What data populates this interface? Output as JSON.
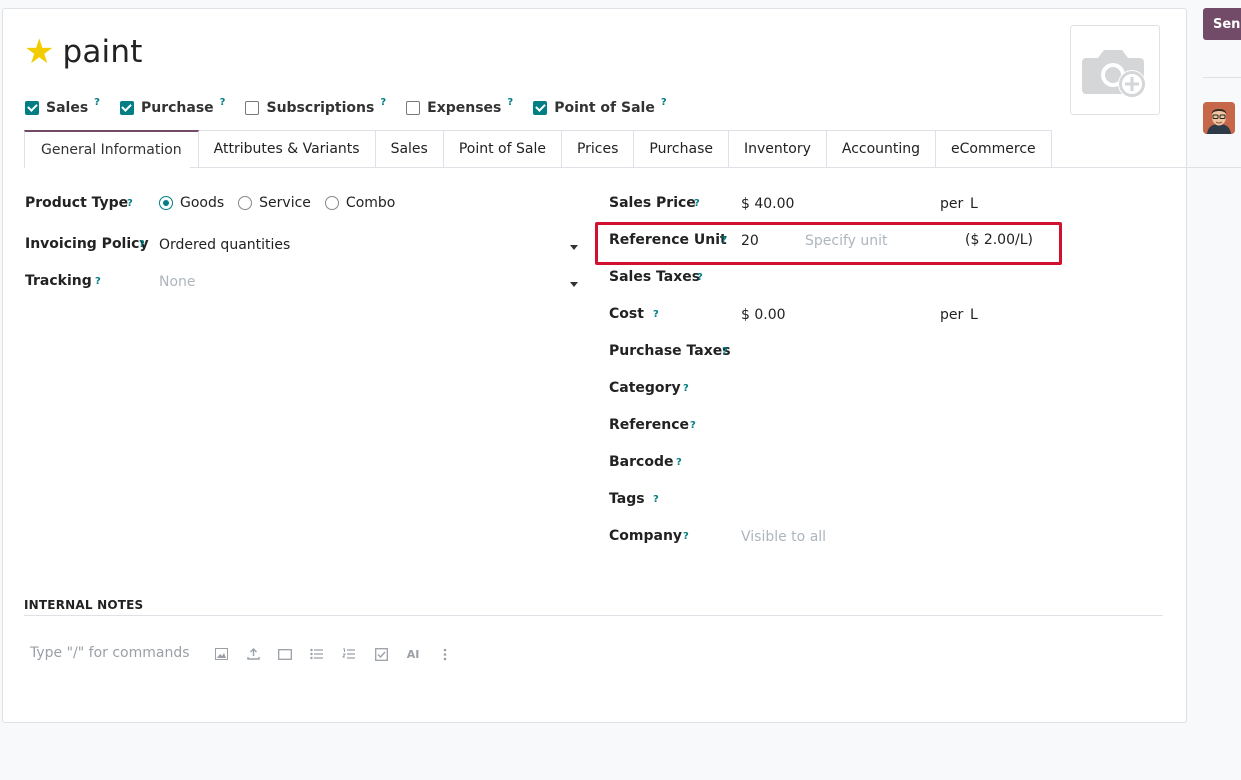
{
  "product": {
    "name": "paint"
  },
  "flags": [
    {
      "label": "Sales",
      "checked": true
    },
    {
      "label": "Purchase",
      "checked": true
    },
    {
      "label": "Subscriptions",
      "checked": false
    },
    {
      "label": "Expenses",
      "checked": false
    },
    {
      "label": "Point of Sale",
      "checked": true
    }
  ],
  "help_mark": "?",
  "tabs": [
    "General Information",
    "Attributes & Variants",
    "Sales",
    "Point of Sale",
    "Prices",
    "Purchase",
    "Inventory",
    "Accounting",
    "eCommerce"
  ],
  "left": {
    "product_type": {
      "label": "Product Type",
      "options": [
        "Goods",
        "Service",
        "Combo"
      ],
      "selected": "Goods"
    },
    "invoicing_policy": {
      "label": "Invoicing Policy",
      "value": "Ordered quantities"
    },
    "tracking": {
      "label": "Tracking",
      "placeholder": "None"
    }
  },
  "right": {
    "sales_price": {
      "label": "Sales Price",
      "value": "$ 40.00",
      "per": "per",
      "unit": "L"
    },
    "reference_unit": {
      "label": "Reference Unit",
      "value": "20",
      "placeholder": "Specify unit",
      "computed": "($ 2.00/L)"
    },
    "sales_taxes": {
      "label": "Sales Taxes"
    },
    "cost": {
      "label": "Cost",
      "value": "$ 0.00",
      "per": "per",
      "unit": "L"
    },
    "purchase_taxes": {
      "label": "Purchase Taxes"
    },
    "category": {
      "label": "Category"
    },
    "reference": {
      "label": "Reference"
    },
    "barcode": {
      "label": "Barcode"
    },
    "tags": {
      "label": "Tags"
    },
    "company": {
      "label": "Company",
      "placeholder": "Visible to all"
    }
  },
  "notes": {
    "title": "INTERNAL NOTES",
    "placeholder": "Type \"/\" for commands",
    "ai_label": "AI"
  },
  "chatter": {
    "send_label": "Send"
  },
  "colors": {
    "accent": "#017e84",
    "brand": "#714b67",
    "highlight": "#d1112f",
    "star": "#f3cc00"
  }
}
